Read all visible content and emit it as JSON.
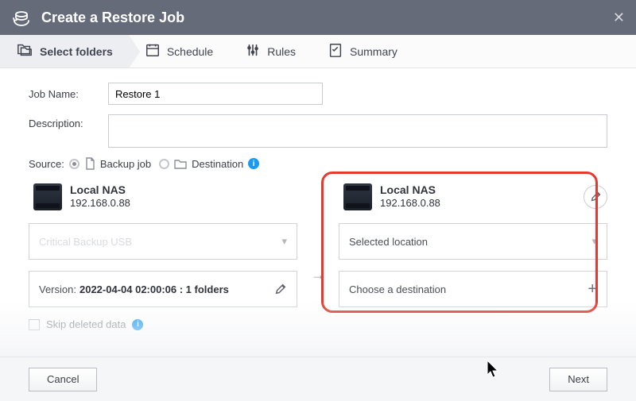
{
  "titlebar": {
    "title": "Create a Restore Job"
  },
  "steps": {
    "select_folders": "Select folders",
    "schedule": "Schedule",
    "rules": "Rules",
    "summary": "Summary"
  },
  "form": {
    "job_name_label": "Job Name:",
    "job_name_value": "Restore 1",
    "description_label": "Description:",
    "description_value": ""
  },
  "source": {
    "label": "Source:",
    "backup_job": "Backup job",
    "destination": "Destination"
  },
  "left": {
    "device_name": "Local NAS",
    "device_ip": "192.168.0.88",
    "dropdown_text": "Critical Backup USB",
    "version_label": "Version:",
    "version_value": "2022-04-04 02:00:06 : 1 folders"
  },
  "right": {
    "device_name": "Local NAS",
    "device_ip": "192.168.0.88",
    "selected_location": "Selected location",
    "choose_destination": "Choose a destination"
  },
  "skip": {
    "label": "Skip deleted data"
  },
  "footer": {
    "cancel": "Cancel",
    "next": "Next"
  }
}
